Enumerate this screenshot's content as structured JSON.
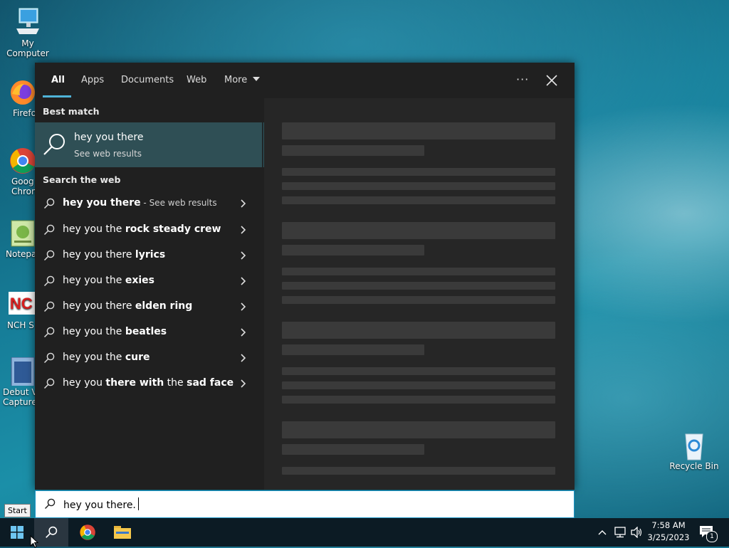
{
  "desktop": {
    "icons": [
      {
        "label": "My Computer"
      },
      {
        "label": "Firefo"
      },
      {
        "label": "Goog\nChron"
      },
      {
        "label": "Notepa"
      },
      {
        "label": "NCH S"
      },
      {
        "label": "Debut V\nCapture"
      },
      {
        "label": "Recycle Bin"
      }
    ]
  },
  "search_panel": {
    "tabs": [
      {
        "label": "All",
        "active": true
      },
      {
        "label": "Apps"
      },
      {
        "label": "Documents"
      },
      {
        "label": "Web"
      },
      {
        "label": "More"
      }
    ],
    "more_options": "···",
    "best_match": {
      "section_title": "Best match",
      "title": "hey you there",
      "subtitle": "See web results"
    },
    "search_web": {
      "section_title": "Search the web",
      "results": [
        {
          "plain": "hey you there",
          "bold": "",
          "suffix": " - See web results",
          "first_bold": true
        },
        {
          "plain": "hey you the ",
          "bold": "rock steady crew"
        },
        {
          "plain": "hey you there ",
          "bold": "lyrics"
        },
        {
          "plain": "hey you the ",
          "bold": "exies"
        },
        {
          "plain": "hey you there ",
          "bold": "elden ring"
        },
        {
          "plain": "hey you the ",
          "bold": "beatles"
        },
        {
          "plain": "hey you the ",
          "bold": "cure"
        },
        {
          "plain": "hey you ",
          "bold": "there with",
          "plain2": " the ",
          "bold2": "sad face"
        }
      ]
    }
  },
  "searchbox": {
    "value": "hey you there."
  },
  "tooltip": "Start",
  "taskbar": {
    "time": "7:58 AM",
    "date": "3/25/2023",
    "notification_count": "1"
  },
  "colors": {
    "accent": "#4fb4d8",
    "best_match_bg": "#2f4f55",
    "panel_bg": "#202020"
  }
}
